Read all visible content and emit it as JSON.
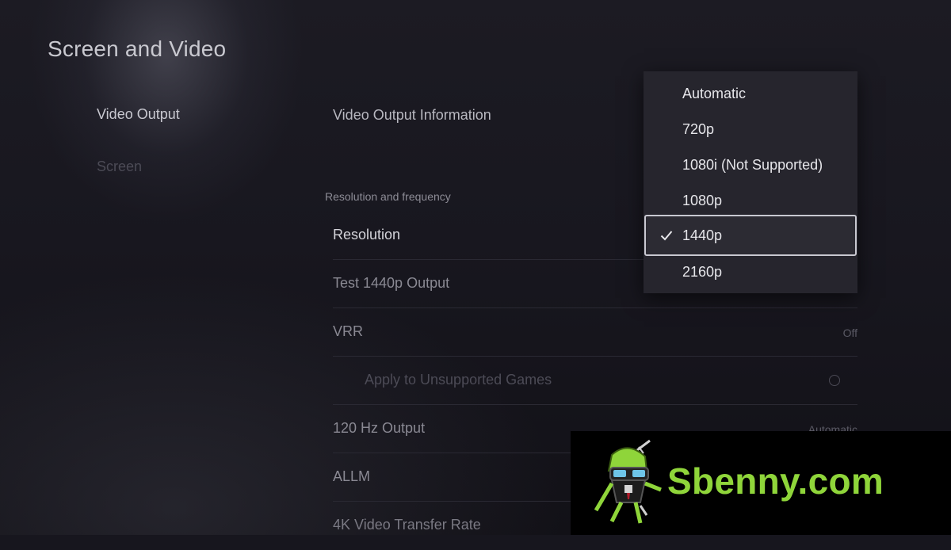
{
  "page": {
    "title": "Screen and Video"
  },
  "sidebar": {
    "items": [
      {
        "label": "Video Output",
        "active": true
      },
      {
        "label": "Screen",
        "active": false
      }
    ]
  },
  "main": {
    "info_row": "Video Output Information",
    "section_header": "Resolution and frequency",
    "rows": {
      "resolution": {
        "label": "Resolution"
      },
      "test_output": {
        "label": "Test 1440p Output"
      },
      "vrr": {
        "label": "VRR",
        "value": "Off"
      },
      "apply_unsupported": {
        "label": "Apply to Unsupported Games",
        "toggle": false
      },
      "hz120": {
        "label": "120 Hz Output",
        "value": "Automatic"
      },
      "allm": {
        "label": "ALLM"
      },
      "transfer_rate": {
        "label": "4K Video Transfer Rate"
      }
    }
  },
  "dropdown": {
    "options": [
      "Automatic",
      "720p",
      "1080i (Not Supported)",
      "1080p",
      "1440p",
      "2160p"
    ],
    "selected": "1440p"
  },
  "watermark": {
    "text": "Sbenny.com"
  },
  "icons": {
    "check": "check-icon",
    "toggle": "toggle-icon",
    "logo": "android-mascot-logo"
  },
  "colors": {
    "background": "#17161e",
    "dropdown": "#26252d",
    "watermark_green": "#8fd53a"
  }
}
